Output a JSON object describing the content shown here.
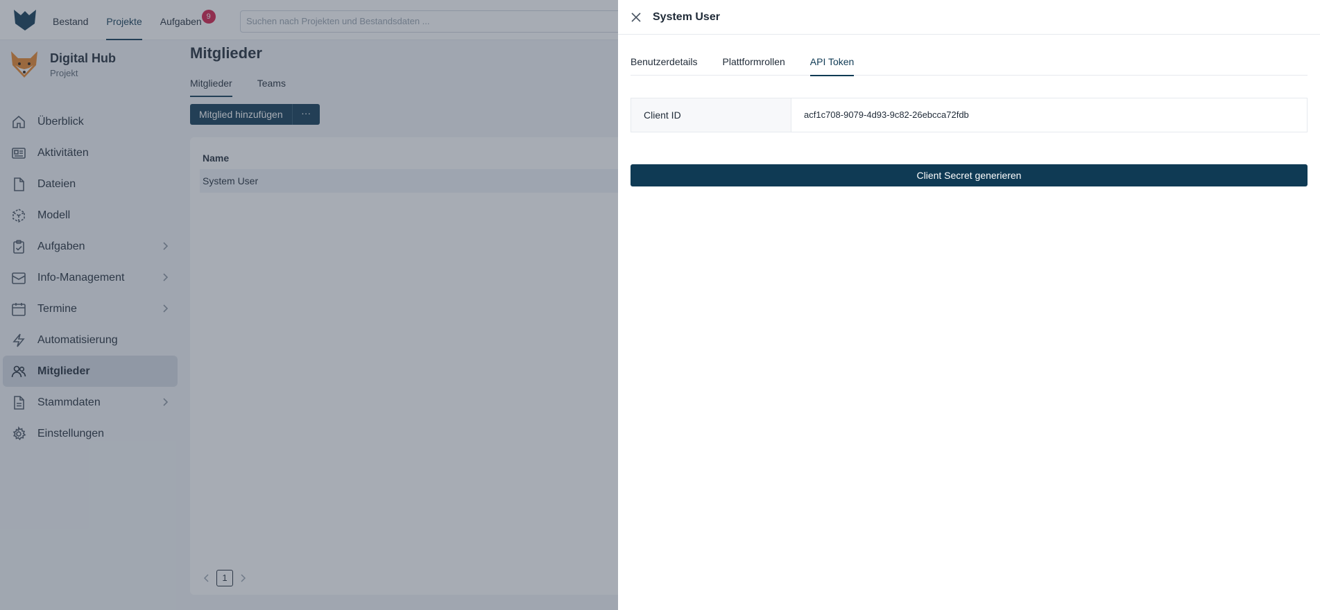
{
  "topnav": {
    "items": [
      "Bestand",
      "Projekte",
      "Aufgaben"
    ],
    "active_index": 1,
    "tasks_badge": "9",
    "search_placeholder": "Suchen nach Projekten und Bestandsdaten ..."
  },
  "project": {
    "name": "Digital Hub",
    "type": "Projekt"
  },
  "sidebar": {
    "items": [
      {
        "label": "Überblick",
        "icon": "home-icon",
        "has_children": false
      },
      {
        "label": "Aktivitäten",
        "icon": "newspaper-icon",
        "has_children": false
      },
      {
        "label": "Dateien",
        "icon": "file-icon",
        "has_children": false
      },
      {
        "label": "Modell",
        "icon": "cube-icon",
        "has_children": false
      },
      {
        "label": "Aufgaben",
        "icon": "clipboard-check-icon",
        "has_children": true
      },
      {
        "label": "Info-Management",
        "icon": "inbox-icon",
        "has_children": true
      },
      {
        "label": "Termine",
        "icon": "calendar-icon",
        "has_children": true
      },
      {
        "label": "Automatisierung",
        "icon": "lightning-icon",
        "has_children": false
      },
      {
        "label": "Mitglieder",
        "icon": "users-icon",
        "has_children": false
      },
      {
        "label": "Stammdaten",
        "icon": "document-icon",
        "has_children": true
      },
      {
        "label": "Einstellungen",
        "icon": "gear-icon",
        "has_children": false
      }
    ],
    "active_index": 8
  },
  "main": {
    "title": "Mitglieder",
    "tabs": [
      "Mitglieder",
      "Teams"
    ],
    "add_button": "Mitglied hinzufügen",
    "more_button": "···",
    "table": {
      "header": "Name",
      "rows": [
        "System User"
      ]
    },
    "pagination": {
      "current_page": "1"
    }
  },
  "drawer": {
    "title": "System User",
    "tabs": [
      "Benutzerdetails",
      "Plattformrollen",
      "API Token"
    ],
    "active_tab": 2,
    "client_id_label": "Client ID",
    "client_id_value": "acf1c708-9079-4d93-9c82-26ebcca72fdb",
    "generate_button": "Client Secret generieren"
  },
  "colors": {
    "primary": "#0f3a54",
    "badge": "#d61c48",
    "overlay": "#3c4858"
  }
}
